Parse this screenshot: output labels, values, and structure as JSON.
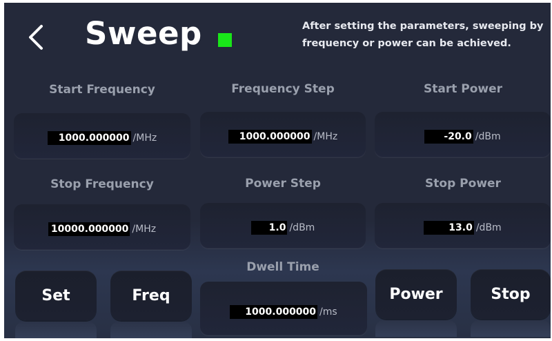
{
  "header": {
    "title": "Sweep",
    "status_color": "#19e619",
    "hint_line1": "After setting the parameters, sweeping by",
    "hint_line2": "frequency or power can be achieved."
  },
  "fields": {
    "start_frequency": {
      "label": "Start Frequency",
      "value": "1000.000000",
      "unit": "/MHz"
    },
    "frequency_step": {
      "label": "Frequency Step",
      "value": "1000.000000",
      "unit": "/MHz"
    },
    "start_power": {
      "label": "Start Power",
      "value": "-20.0",
      "unit": "/dBm"
    },
    "stop_frequency": {
      "label": "Stop Frequency",
      "value": "10000.000000",
      "unit": "/MHz"
    },
    "power_step": {
      "label": "Power Step",
      "value": "1.0",
      "unit": "/dBm"
    },
    "stop_power": {
      "label": "Stop Power",
      "value": "13.0",
      "unit": "/dBm"
    },
    "dwell_time": {
      "label": "Dwell Time",
      "value": "1000.000000",
      "unit": "/ms"
    }
  },
  "buttons": {
    "set": "Set",
    "freq": "Freq",
    "power": "Power",
    "stop": "Stop"
  }
}
